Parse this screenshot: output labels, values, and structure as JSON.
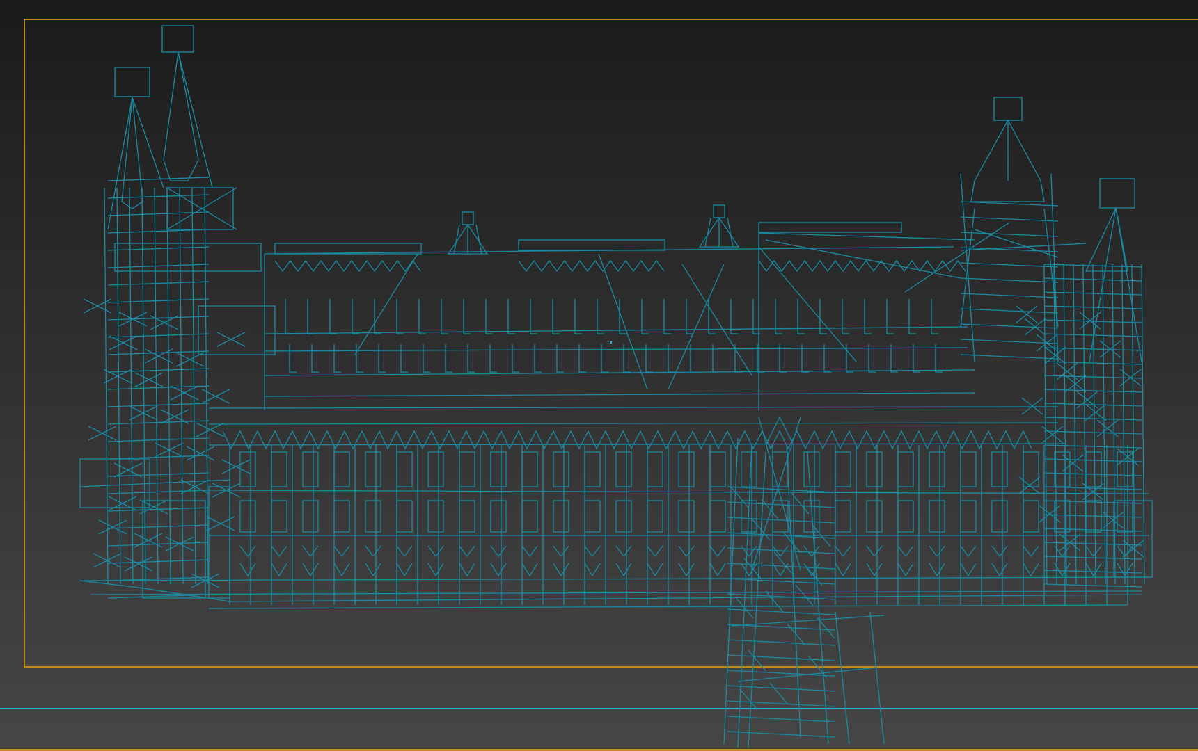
{
  "viewport": {
    "view_mode": "wireframe",
    "wire_color": "#1a8ba4",
    "safe_frame_color": "#c08a18",
    "grid_line_color": "#22b4c4",
    "background_top": "#1b1b1b",
    "background_bottom": "#464646",
    "object": "castle-wireframe-model"
  }
}
